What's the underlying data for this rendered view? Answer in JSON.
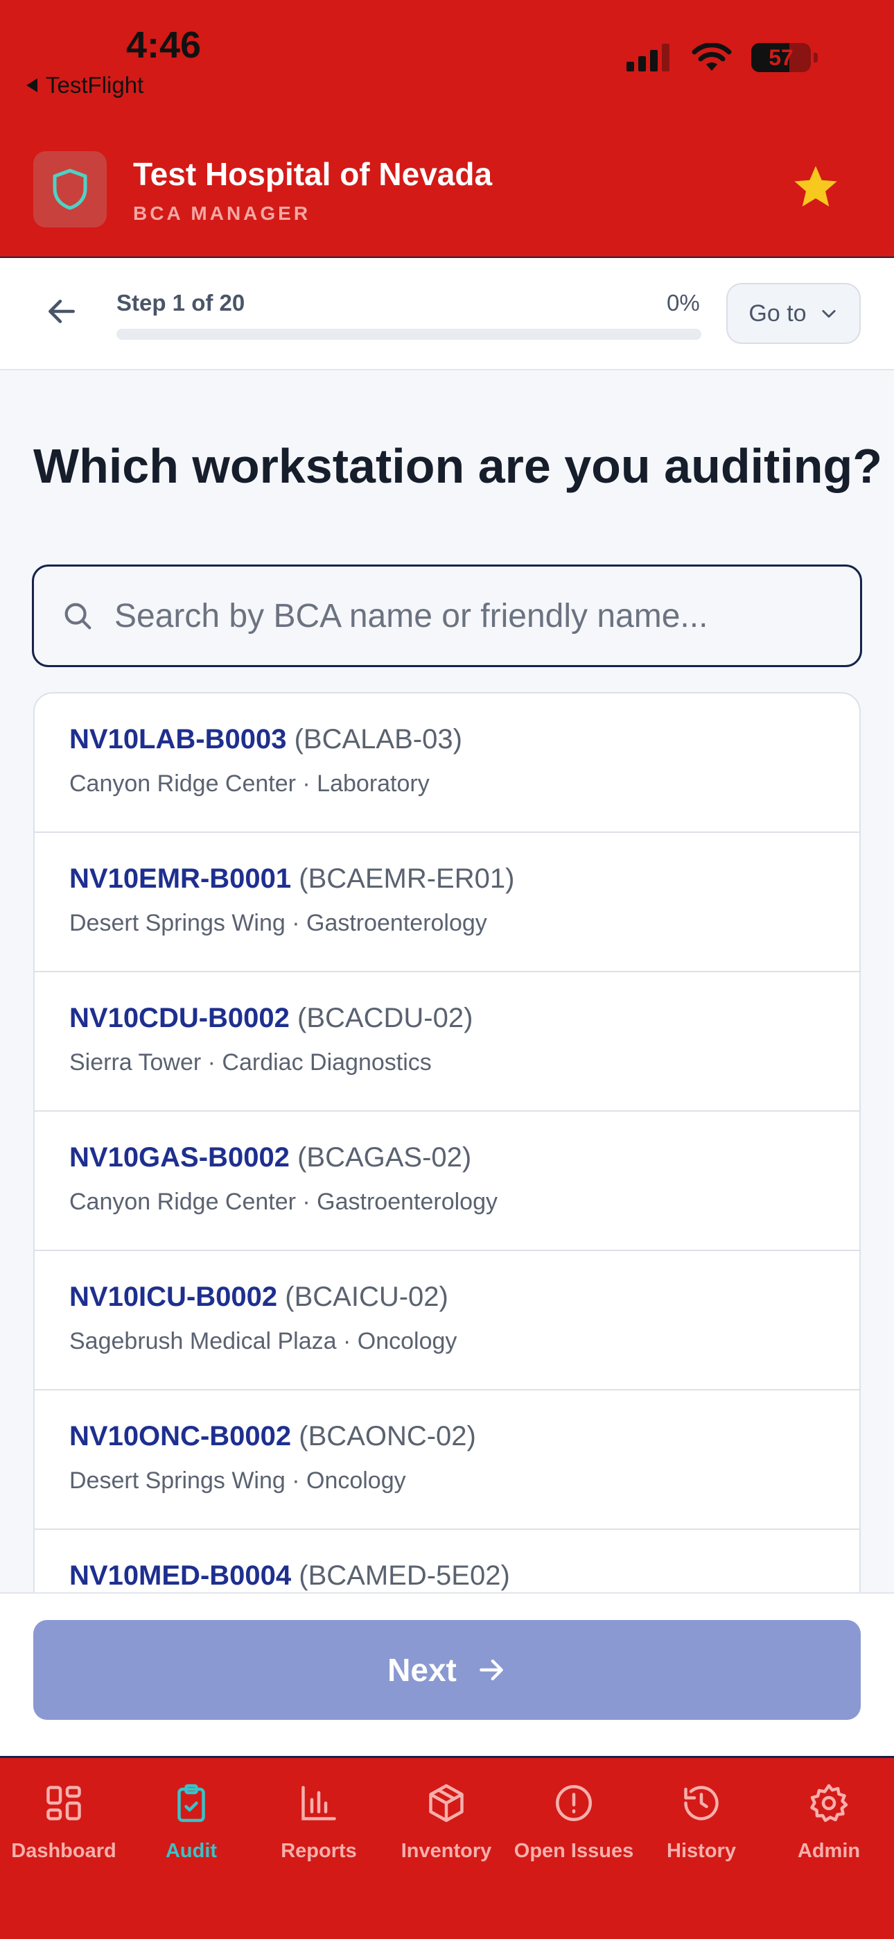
{
  "status_bar": {
    "time": "4:46",
    "back_app": "TestFlight",
    "battery": "57"
  },
  "app_header": {
    "title": "Test Hospital of Nevada",
    "subtitle": "BCA MANAGER"
  },
  "step_bar": {
    "step_label": "Step 1 of 20",
    "progress_text": "0%",
    "progress_value": 0,
    "goto_label": "Go to"
  },
  "main": {
    "question": "Which workstation are you auditing?",
    "search_placeholder": "Search by BCA name or friendly name...",
    "search_value": ""
  },
  "workstations": [
    {
      "code": "NV10LAB-B0003",
      "friendly": "(BCALAB-03)",
      "location": "Canyon Ridge Center · Laboratory"
    },
    {
      "code": "NV10EMR-B0001",
      "friendly": "(BCAEMR-ER01)",
      "location": "Desert Springs Wing · Gastroenterology"
    },
    {
      "code": "NV10CDU-B0002",
      "friendly": "(BCACDU-02)",
      "location": "Sierra Tower · Cardiac Diagnostics"
    },
    {
      "code": "NV10GAS-B0002",
      "friendly": "(BCAGAS-02)",
      "location": "Canyon Ridge Center · Gastroenterology"
    },
    {
      "code": "NV10ICU-B0002",
      "friendly": "(BCAICU-02)",
      "location": "Sagebrush Medical Plaza · Oncology"
    },
    {
      "code": "NV10ONC-B0002",
      "friendly": "(BCAONC-02)",
      "location": "Desert Springs Wing · Oncology"
    },
    {
      "code": "NV10MED-B0004",
      "friendly": "(BCAMED-5E02)",
      "location": ""
    }
  ],
  "footer": {
    "next_label": "Next"
  },
  "bottom_nav": [
    {
      "label": "Dashboard",
      "icon": "grid-icon"
    },
    {
      "label": "Audit",
      "icon": "clipboard-check-icon",
      "active": true
    },
    {
      "label": "Reports",
      "icon": "bar-chart-icon"
    },
    {
      "label": "Inventory",
      "icon": "box-icon"
    },
    {
      "label": "Open Issues",
      "icon": "alert-circle-icon"
    },
    {
      "label": "History",
      "icon": "history-icon"
    },
    {
      "label": "Admin",
      "icon": "gear-icon"
    }
  ],
  "colors": {
    "brand_red": "#d31a17",
    "primary_navy": "#1e2f8f",
    "next_disabled": "#8a99d2",
    "nav_active": "#39c2c9",
    "star": "#f7c81e"
  }
}
